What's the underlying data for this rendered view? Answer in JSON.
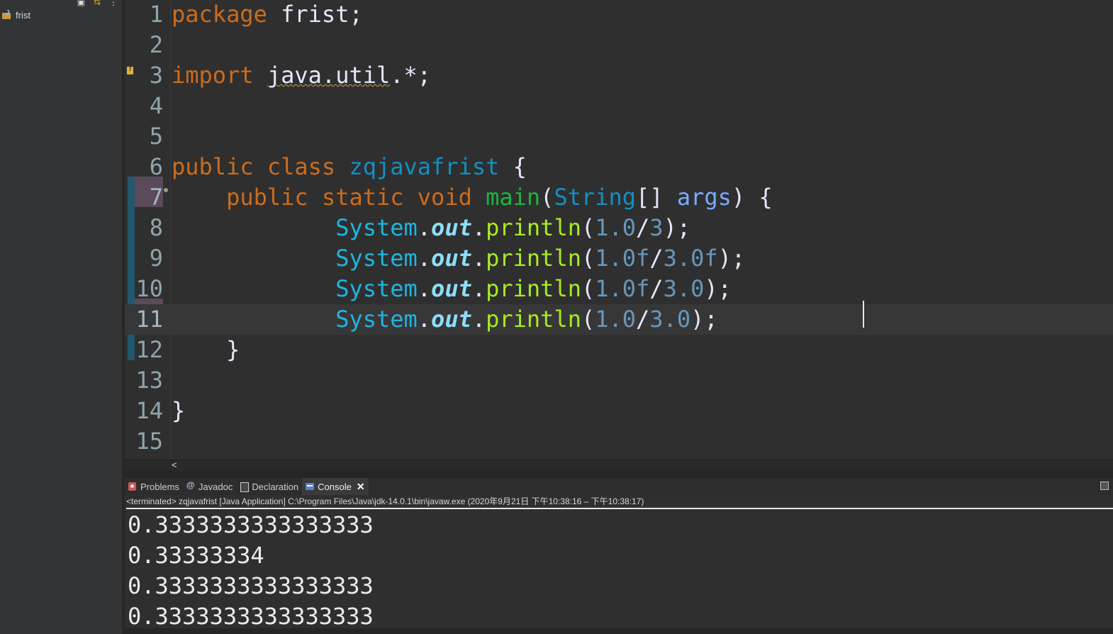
{
  "explorer": {
    "project_name": "frist",
    "toolbar_icons": [
      "collapse-all-icon",
      "link-with-editor-icon",
      "view-menu-icon"
    ]
  },
  "editor": {
    "current_line": 11,
    "lines": [
      {
        "n": "1",
        "tokens": [
          {
            "t": "package",
            "c": "kw"
          },
          {
            "t": " frist;",
            "c": "pl"
          }
        ]
      },
      {
        "n": "2",
        "tokens": []
      },
      {
        "n": "3",
        "tokens": [
          {
            "t": "import",
            "c": "kw"
          },
          {
            "t": " ",
            "c": "pl"
          },
          {
            "t": "java.util",
            "c": "pl warn"
          },
          {
            "t": ".*;",
            "c": "pl"
          }
        ]
      },
      {
        "n": "4",
        "tokens": []
      },
      {
        "n": "5",
        "tokens": []
      },
      {
        "n": "6",
        "tokens": [
          {
            "t": "public",
            "c": "kw"
          },
          {
            "t": " ",
            "c": "pl"
          },
          {
            "t": "class",
            "c": "kw"
          },
          {
            "t": " ",
            "c": "pl"
          },
          {
            "t": "zqjavafrist",
            "c": "ty"
          },
          {
            "t": " {",
            "c": "pl"
          }
        ]
      },
      {
        "n": "7",
        "tokens": [
          {
            "t": "    ",
            "c": "pl"
          },
          {
            "t": "public",
            "c": "kw"
          },
          {
            "t": " ",
            "c": "pl"
          },
          {
            "t": "static",
            "c": "kw"
          },
          {
            "t": " ",
            "c": "pl"
          },
          {
            "t": "void",
            "c": "kw"
          },
          {
            "t": " ",
            "c": "pl"
          },
          {
            "t": "main",
            "c": "mn"
          },
          {
            "t": "(",
            "c": "pl"
          },
          {
            "t": "String",
            "c": "ty"
          },
          {
            "t": "[] ",
            "c": "pl"
          },
          {
            "t": "args",
            "c": "ar"
          },
          {
            "t": ") {",
            "c": "pl"
          }
        ]
      },
      {
        "n": "8",
        "tokens": [
          {
            "t": "            ",
            "c": "pl"
          },
          {
            "t": "System",
            "c": "sy"
          },
          {
            "t": ".",
            "c": "pl"
          },
          {
            "t": "out",
            "c": "ou"
          },
          {
            "t": ".",
            "c": "pl"
          },
          {
            "t": "println",
            "c": "fn"
          },
          {
            "t": "(",
            "c": "pl"
          },
          {
            "t": "1.0",
            "c": "nu"
          },
          {
            "t": "/",
            "c": "pl"
          },
          {
            "t": "3",
            "c": "nu"
          },
          {
            "t": ");",
            "c": "pl"
          }
        ]
      },
      {
        "n": "9",
        "tokens": [
          {
            "t": "            ",
            "c": "pl"
          },
          {
            "t": "System",
            "c": "sy"
          },
          {
            "t": ".",
            "c": "pl"
          },
          {
            "t": "out",
            "c": "ou"
          },
          {
            "t": ".",
            "c": "pl"
          },
          {
            "t": "println",
            "c": "fn"
          },
          {
            "t": "(",
            "c": "pl"
          },
          {
            "t": "1.0f",
            "c": "nu"
          },
          {
            "t": "/",
            "c": "pl"
          },
          {
            "t": "3.0f",
            "c": "nu"
          },
          {
            "t": ");",
            "c": "pl"
          }
        ]
      },
      {
        "n": "10",
        "tokens": [
          {
            "t": "            ",
            "c": "pl"
          },
          {
            "t": "System",
            "c": "sy"
          },
          {
            "t": ".",
            "c": "pl"
          },
          {
            "t": "out",
            "c": "ou"
          },
          {
            "t": ".",
            "c": "pl"
          },
          {
            "t": "println",
            "c": "fn"
          },
          {
            "t": "(",
            "c": "pl"
          },
          {
            "t": "1.0f",
            "c": "nu"
          },
          {
            "t": "/",
            "c": "pl"
          },
          {
            "t": "3.0",
            "c": "nu"
          },
          {
            "t": ");",
            "c": "pl"
          }
        ]
      },
      {
        "n": "11",
        "tokens": [
          {
            "t": "            ",
            "c": "pl"
          },
          {
            "t": "System",
            "c": "sy"
          },
          {
            "t": ".",
            "c": "pl"
          },
          {
            "t": "out",
            "c": "ou"
          },
          {
            "t": ".",
            "c": "pl"
          },
          {
            "t": "println",
            "c": "fn"
          },
          {
            "t": "(",
            "c": "pl"
          },
          {
            "t": "1.0",
            "c": "nu"
          },
          {
            "t": "/",
            "c": "pl"
          },
          {
            "t": "3.0",
            "c": "nu"
          },
          {
            "t": ");",
            "c": "pl"
          }
        ]
      },
      {
        "n": "12",
        "tokens": [
          {
            "t": "    }",
            "c": "pl"
          }
        ]
      },
      {
        "n": "13",
        "tokens": []
      },
      {
        "n": "14",
        "tokens": [
          {
            "t": "}",
            "c": "pl"
          }
        ]
      },
      {
        "n": "15",
        "tokens": []
      }
    ]
  },
  "scrollbar": {
    "left_arrow": "<"
  },
  "panel": {
    "tabs": [
      {
        "label": "Problems",
        "icon": "problems-icon"
      },
      {
        "label": "Javadoc",
        "icon": "javadoc-icon"
      },
      {
        "label": "Declaration",
        "icon": "declaration-icon"
      },
      {
        "label": "Console",
        "icon": "console-icon",
        "active": true
      }
    ],
    "close_label": "✕",
    "status": "<terminated> zqjavafrist [Java Application] C:\\Program Files\\Java\\jdk-14.0.1\\bin\\javaw.exe  (2020年9月21日 下午10:38:16 – 下午10:38:17)",
    "output": [
      "0.3333333333333333",
      "0.33333334",
      "0.3333333333333333",
      "0.3333333333333333"
    ]
  },
  "colors": {
    "keyword": "#cc6c1d",
    "type": "#1290c3",
    "method": "#a7ec21",
    "number": "#6897bb",
    "background": "#2f2f2f"
  }
}
